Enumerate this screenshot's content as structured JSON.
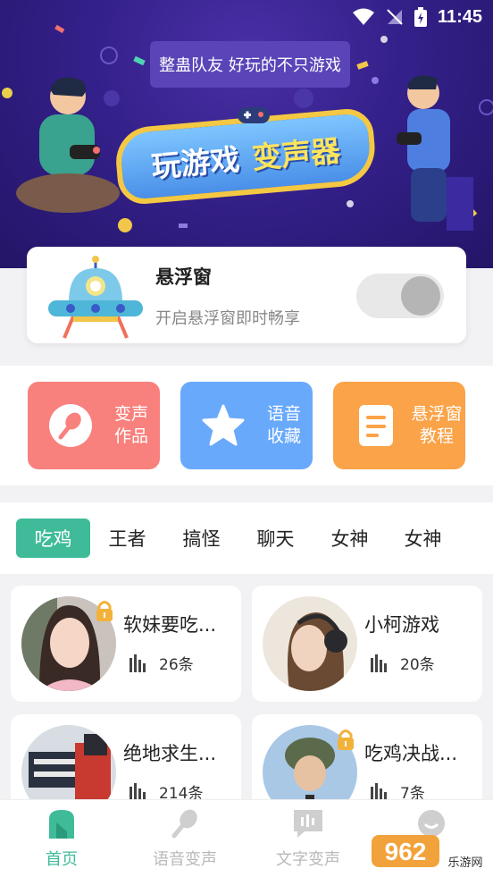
{
  "status_bar": {
    "time": "11:45"
  },
  "banner": {
    "slogan": "整蛊队友 好玩的不只游戏",
    "title_part1": "玩游戏",
    "title_part2": "变声器"
  },
  "float_window": {
    "title": "悬浮窗",
    "subtitle": "开启悬浮窗即时畅享",
    "enabled": false
  },
  "features": [
    {
      "label": "变声作品",
      "icon": "microphone-icon",
      "color": "#f8807d"
    },
    {
      "label": "语音收藏",
      "icon": "star-icon",
      "color": "#68a9fb"
    },
    {
      "label": "悬浮窗教程",
      "icon": "document-icon",
      "color": "#fba348"
    }
  ],
  "category_tabs": {
    "active": "吃鸡",
    "items": [
      "吃鸡",
      "王者",
      "搞怪",
      "聊天",
      "女神",
      "女神"
    ]
  },
  "voice_packs": [
    {
      "name": "软妹要吃...",
      "count": "26条",
      "locked": true
    },
    {
      "name": "小柯游戏",
      "count": "20条",
      "locked": false
    },
    {
      "name": "绝地求生...",
      "count": "214条",
      "locked": false
    },
    {
      "name": "吃鸡决战...",
      "count": "7条",
      "locked": true
    }
  ],
  "bottom_nav": [
    {
      "label": "首页",
      "icon": "home-icon",
      "active": true
    },
    {
      "label": "语音变声",
      "icon": "microphone-icon",
      "active": false
    },
    {
      "label": "文字变声",
      "icon": "text-voice-icon",
      "active": false
    },
    {
      "label": "",
      "icon": "profile-icon",
      "active": false
    }
  ],
  "watermark": {
    "text": "962.NET",
    "subtext": "乐游网"
  },
  "colors": {
    "accent": "#3fbb99",
    "banner": "#34208a"
  }
}
